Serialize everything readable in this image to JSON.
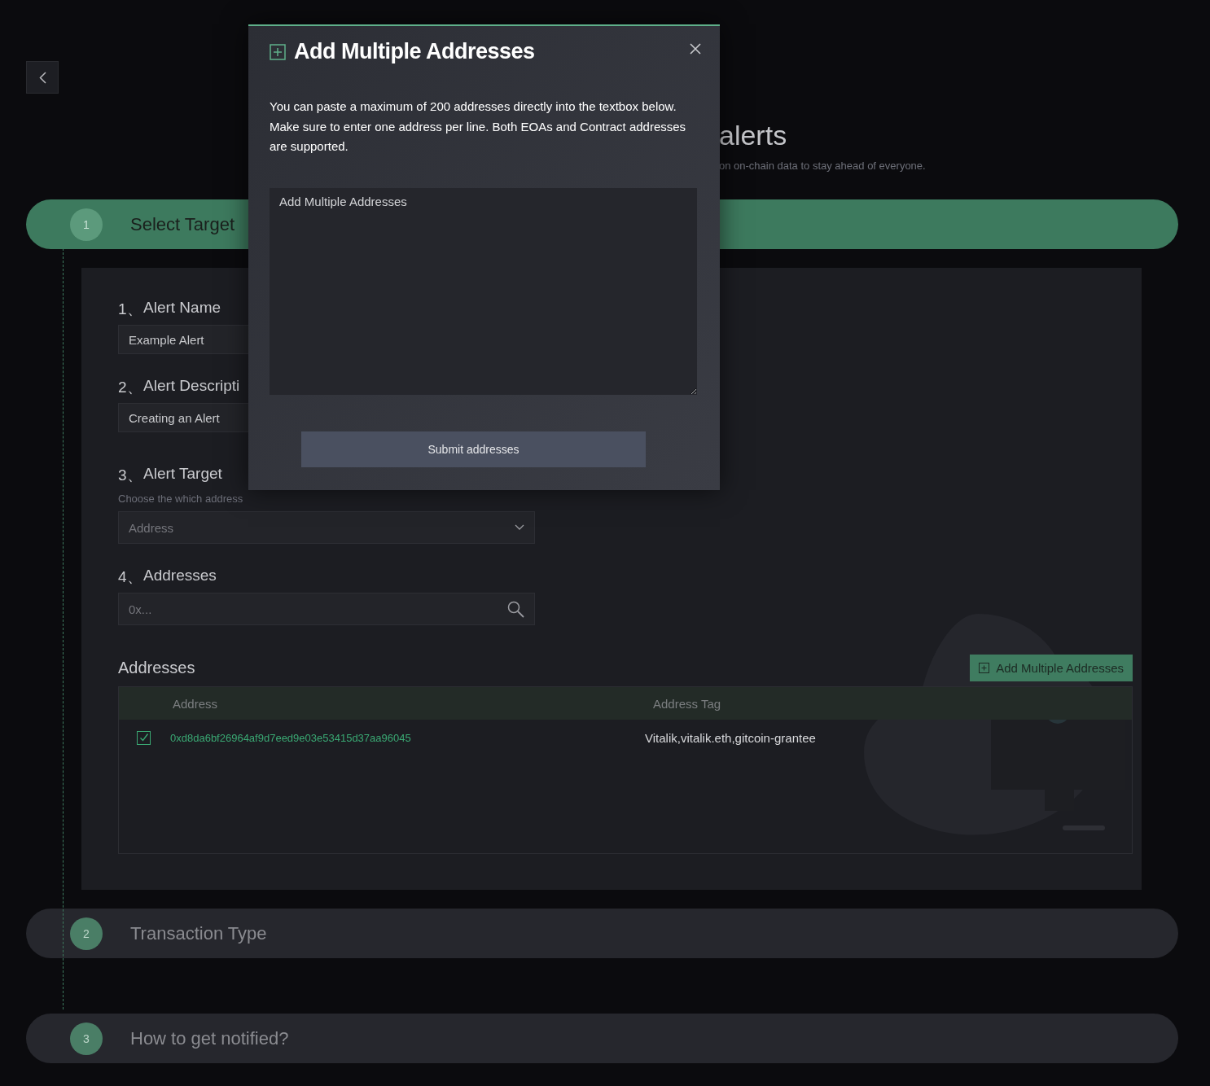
{
  "header": {
    "title": "alerts",
    "subtitle": "on on-chain data to stay ahead of everyone."
  },
  "steps": [
    {
      "number": "1",
      "title": "Select Target",
      "expanded": true
    },
    {
      "number": "2",
      "title": "Transaction Type",
      "expanded": false
    },
    {
      "number": "3",
      "title": "How to get notified?",
      "expanded": false
    }
  ],
  "form": {
    "fields": [
      {
        "kind": "text",
        "number": "1、",
        "label": "Alert Name",
        "value": "Example Alert"
      },
      {
        "kind": "text",
        "number": "2、",
        "label": "Alert Descripti",
        "value": "Creating an Alert"
      },
      {
        "kind": "select",
        "number": "3、",
        "label": "Alert Target",
        "hint": "Choose the which address",
        "value": "Address"
      },
      {
        "kind": "search",
        "number": "4、",
        "label": "Addresses",
        "placeholder": "0x..."
      }
    ]
  },
  "addresses": {
    "title": "Addresses",
    "add_button": "Add Multiple Addresses",
    "columns": [
      "Address",
      "Address Tag"
    ],
    "rows": [
      {
        "checked": true,
        "address": "0xd8da6bf26964af9d7eed9e03e53415d37aa96045",
        "tag": "Vitalik,vitalik.eth,gitcoin-grantee"
      }
    ]
  },
  "modal": {
    "title": "Add Multiple Addresses",
    "description": "You can paste a maximum of 200 addresses directly into the textbox below. Make sure to enter one address per line. Both EOAs and Contract addresses are supported.",
    "textarea": {
      "placeholder": "Add Multiple Addresses"
    },
    "submit_button": "Submit addresses"
  }
}
